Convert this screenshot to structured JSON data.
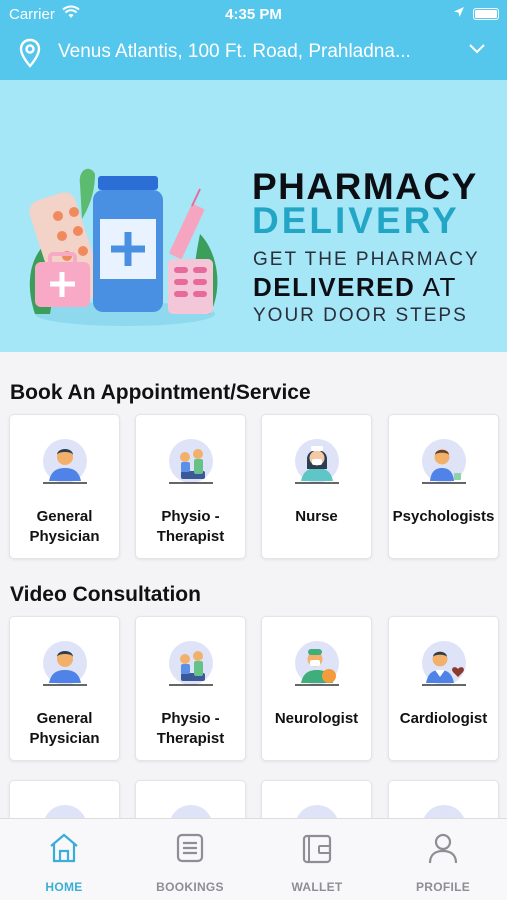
{
  "status_bar": {
    "carrier": "Carrier",
    "time": "4:35 PM"
  },
  "location": {
    "address": "Venus Atlantis, 100 Ft. Road, Prahladna..."
  },
  "banner": {
    "title_line1": "PHARMACY",
    "title_line2": "DELIVERY",
    "subtitle_line1": "GET THE PHARMACY",
    "subtitle_bold": "DELIVERED",
    "subtitle_at": " AT",
    "subtitle_line3": "YOUR DOOR STEPS"
  },
  "book_section": {
    "title": "Book An Appointment/Service",
    "items": [
      {
        "label": "General\nPhysician",
        "icon": "doctor-avatar-icon"
      },
      {
        "label": "Physio -\nTherapist",
        "icon": "physio-avatar-icon"
      },
      {
        "label": "Nurse",
        "icon": "nurse-avatar-icon"
      },
      {
        "label": "Psychologists",
        "icon": "psychologist-avatar-icon"
      }
    ]
  },
  "video_section": {
    "title": "Video Consultation",
    "items": [
      {
        "label": "General\nPhysician",
        "icon": "doctor-avatar-icon"
      },
      {
        "label": "Physio -\nTherapist",
        "icon": "physio-avatar-icon"
      },
      {
        "label": "Neurologist",
        "icon": "neurologist-avatar-icon"
      },
      {
        "label": "Cardiologist",
        "icon": "cardiologist-avatar-icon"
      }
    ]
  },
  "tab_bar": {
    "tabs": [
      {
        "label": "HOME",
        "icon": "home-icon",
        "active": true
      },
      {
        "label": "BOOKINGS",
        "icon": "bookings-icon",
        "active": false
      },
      {
        "label": "WALLET",
        "icon": "wallet-icon",
        "active": false
      },
      {
        "label": "PROFILE",
        "icon": "profile-icon",
        "active": false
      }
    ]
  },
  "colors": {
    "accent": "#55c7ec",
    "banner_bg": "#a5e6f7",
    "delivery_text": "#23a6c6",
    "active_tab": "#3aaed6"
  }
}
